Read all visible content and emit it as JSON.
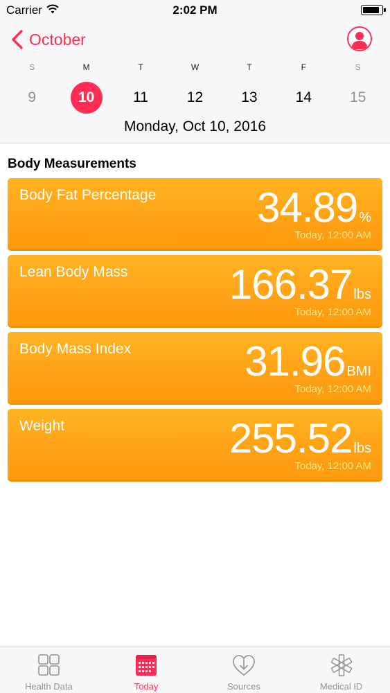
{
  "status_bar": {
    "carrier": "Carrier",
    "time": "2:02 PM",
    "battery_level": 0.9
  },
  "header": {
    "back_label": "October",
    "weekdays": [
      "S",
      "M",
      "T",
      "W",
      "T",
      "F",
      "S"
    ],
    "dates": [
      "9",
      "10",
      "11",
      "12",
      "13",
      "14",
      "15"
    ],
    "selected_index": 1,
    "full_date": "Monday, Oct 10, 2016"
  },
  "section": {
    "title": "Body Measurements",
    "cards": [
      {
        "title": "Body Fat Percentage",
        "value": "34.89",
        "unit": "%",
        "time": "Today, 12:00 AM"
      },
      {
        "title": "Lean Body Mass",
        "value": "166.37",
        "unit": "lbs",
        "time": "Today, 12:00 AM"
      },
      {
        "title": "Body Mass Index",
        "value": "31.96",
        "unit": "BMI",
        "time": "Today, 12:00 AM"
      },
      {
        "title": "Weight",
        "value": "255.52",
        "unit": "lbs",
        "time": "Today, 12:00 AM"
      }
    ]
  },
  "tab_bar": {
    "tabs": [
      {
        "label": "Health Data",
        "icon": "grid-icon"
      },
      {
        "label": "Today",
        "icon": "calendar-icon"
      },
      {
        "label": "Sources",
        "icon": "heart-download-icon"
      },
      {
        "label": "Medical ID",
        "icon": "asterisk-icon"
      }
    ],
    "active_index": 1
  },
  "colors": {
    "accent": "#ff2d55",
    "card": "#ffa216",
    "card_time": "#ffe98a",
    "inactive": "#929292"
  }
}
